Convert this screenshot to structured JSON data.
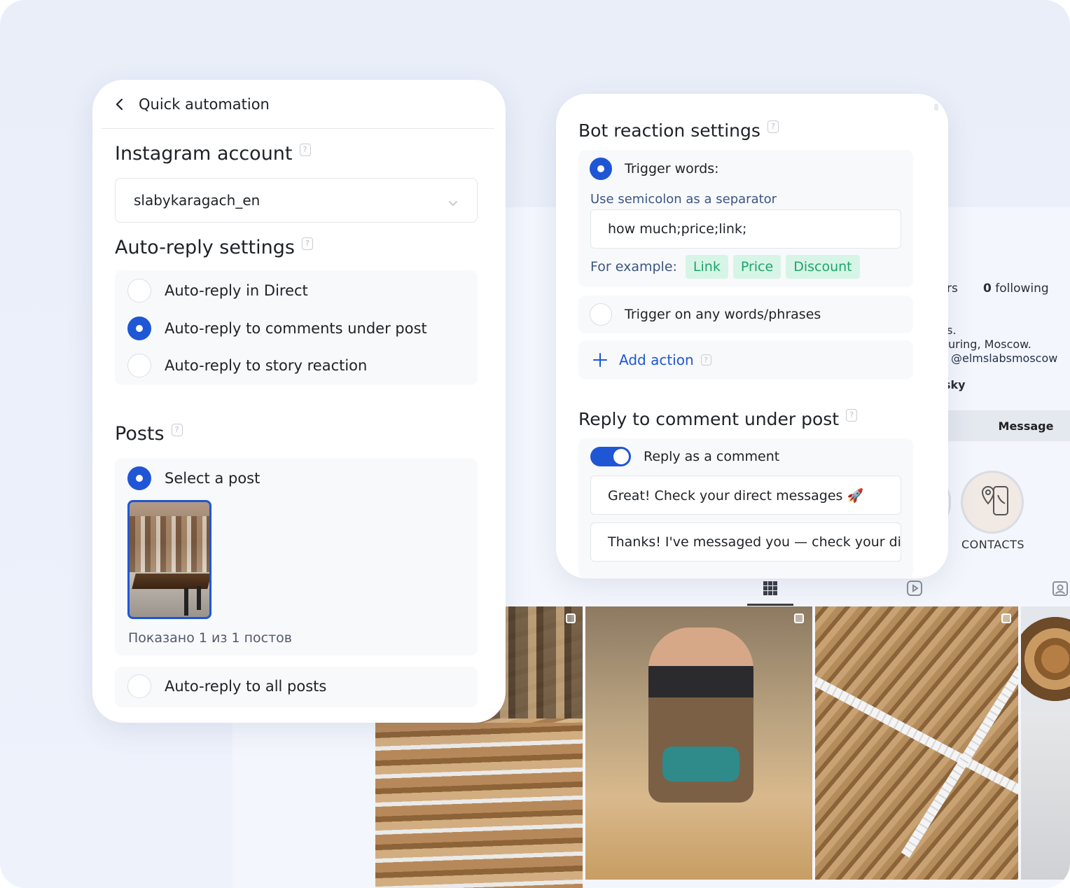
{
  "left_panel": {
    "header": {
      "title": "Quick automation"
    },
    "account": {
      "title": "Instagram account",
      "selected_value": "slabykaragach_en"
    },
    "auto_reply": {
      "title": "Auto-reply settings",
      "options": [
        {
          "label": "Auto-reply in Direct",
          "selected": false
        },
        {
          "label": "Auto-reply to comments under post",
          "selected": true
        },
        {
          "label": "Auto-reply to story reaction",
          "selected": false
        }
      ]
    },
    "posts": {
      "title": "Posts",
      "select_label": "Select a post",
      "shown_count": "Показано 1 из 1 постов",
      "all_posts_label": "Auto-reply to all posts"
    }
  },
  "right_panel": {
    "bot_reaction": {
      "title": "Bot reaction settings",
      "trigger_words_label": "Trigger words:",
      "separator_hint": "Use semicolon as a separator",
      "trigger_words_value": "how much;price;link;",
      "example_label": "For example:",
      "examples": [
        "Link",
        "Price",
        "Discount"
      ],
      "any_words_label": "Trigger on any words/phrases",
      "add_action_label": "Add action"
    },
    "reply_comment": {
      "title": "Reply to comment under post",
      "toggle_label": "Reply as a comment",
      "toggle_on": true,
      "replies": [
        "Great! Check your direct messages 🚀",
        "Thanks! I've messaged you — check your dir"
      ]
    }
  },
  "background_profile": {
    "followers_suffix": "rs",
    "following_count": "0",
    "following_label": "following",
    "bio_lines": [
      "ps.",
      "uring, Moscow.",
      "@elmslabsmoscow",
      "sky"
    ],
    "message_button": "Message",
    "highlight_label": "CONTACTS"
  },
  "colors": {
    "accent": "#1f56d6",
    "chip_bg": "#d7f5e7",
    "chip_text": "#1da46a",
    "hint_text": "#3b5680"
  }
}
